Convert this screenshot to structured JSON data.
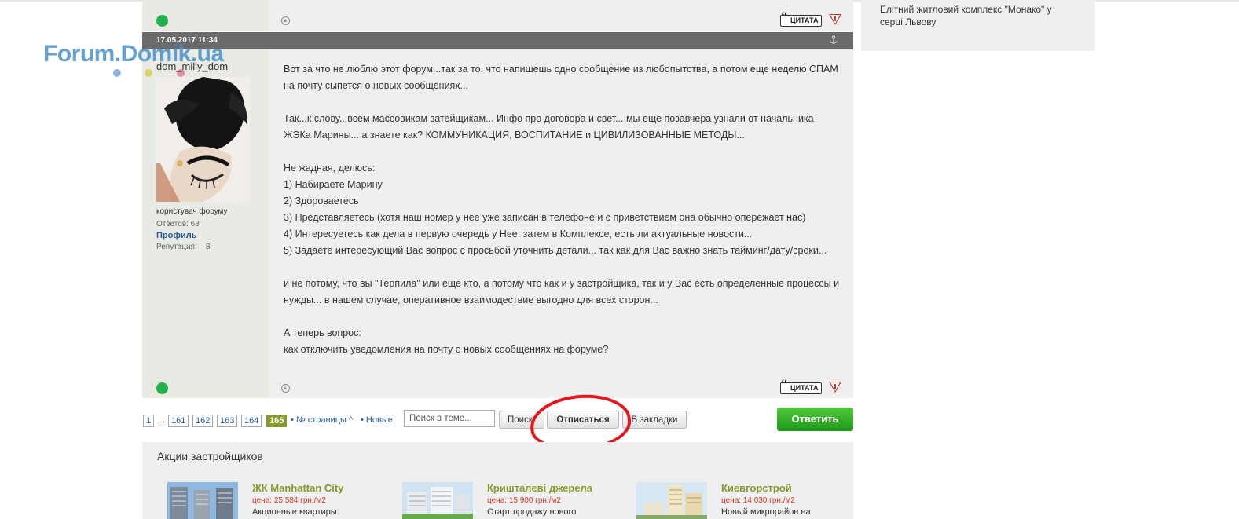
{
  "previous_post": {
    "quote_label": "ЦИТАТА"
  },
  "sidebar": {
    "complex_text": "Елітний житловий комплекс \"Монако\" у серці Львову"
  },
  "logo": {
    "text": "Forum.Domik.ua"
  },
  "post": {
    "date": "17.05.2017 11:34",
    "user": {
      "username": "dom_miliy_dom",
      "role": "користувач форуму",
      "replies": "Ответов: 68",
      "profile_link": "Профиль",
      "reputation": "Репутация:    8"
    },
    "paragraphs": [
      "Вот за что не люблю этот форум...так за то, что напишешь одно сообщение из любопытства, а потом еще неделю СПАМ на почту сыпется о новых сообщениях...",
      "",
      "Так...к слову...всем массовикам затейщикам... Инфо про договора и свет... мы еще позавчера узнали от начальника ЖЭКа Марины... а знаете как? КОММУНИКАЦИЯ, ВОСПИТАНИЕ и ЦИВИЛИЗОВАННЫЕ МЕТОДЫ...",
      "",
      "Не жадная, делюсь:",
      "1) Набираете Марину",
      "2) Здороваетесь",
      "3) Представляетесь (хотя наш номер у нее уже записан в телефоне и с приветствием она обычно опережает нас)",
      "4) Интересуетесь как дела в первую очередь у Нее, затем в Комплексе, есть ли актуальные новости...",
      "5) Задаете интересующий Вас вопрос с просьбой уточнить детали... так как для Вас важно знать тайминг/дату/сроки...",
      "",
      "и не потому, что вы \"Терпила\" или еще кто, а потому что как и у застройщика, так и у Вас есть определенные процессы и нужды... в нашем случае, оперативное взаимодествие выгодно для всех сторон...",
      "",
      "А теперь вопрос:",
      "как отключить уведомления на почту о новых сообщениях на форуме?"
    ],
    "quote_label": "ЦИТАТА"
  },
  "pagination": {
    "first": "1",
    "ellipsis": "...",
    "pages": [
      "161",
      "162",
      "163",
      "164"
    ],
    "current": "165",
    "page_number_link": "• № страницы ^",
    "new_link": "• Новые"
  },
  "toolbar": {
    "search_placeholder": "Поиск в теме...",
    "search_button": "Поиск",
    "unsubscribe_button": "Отписаться",
    "bookmarks_button": "В закладки",
    "reply_button": "Ответить"
  },
  "promotions": {
    "title": "Акции застройщиков",
    "items": [
      {
        "name": "ЖК Manhattan City",
        "price": "цена: 25 584 грн./м2",
        "desc": "Акционные квартиры"
      },
      {
        "name": "Кришталеві джерела",
        "price": "цена: 15 900 грн./м2",
        "desc": "Старт продажу нового"
      },
      {
        "name": "Киевгорстрой",
        "price": "цена: 14 030 грн./м2",
        "desc": "Новый микрорайон на"
      }
    ]
  },
  "colors": {
    "online": "#22b14c",
    "reply_button": "#2aa822",
    "link": "#2a5a9e",
    "current_page": "#8a9a2a",
    "annotation_circle": "#e8141c"
  }
}
